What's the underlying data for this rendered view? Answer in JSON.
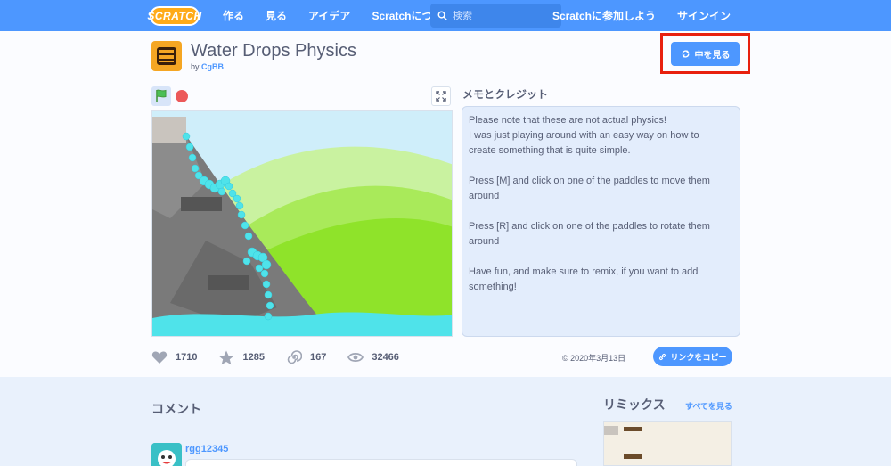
{
  "nav": {
    "logo": "SCRATCH",
    "links": [
      "作る",
      "見る",
      "アイデア",
      "Scratchについて"
    ],
    "search_placeholder": "検索",
    "join": "Scratchに参加しよう",
    "signin": "サインイン"
  },
  "project": {
    "title": "Water Drops Physics",
    "by_prefix": "by",
    "author": "CgBB",
    "see_inside": "中を見る"
  },
  "notes": {
    "title": "メモとクレジット",
    "lines": [
      "Please note that these are not actual physics!",
      "I was just playing around with an easy way on how to",
      "create something that is quite simple.",
      "",
      "Press [M] and click on one of the paddles to move them",
      "around",
      "",
      "Press [R] and click on one of the paddles to rotate them",
      "around",
      "",
      "Have fun, and make sure to remix, if you want to add",
      "something!"
    ]
  },
  "stats": {
    "loves": "1710",
    "favorites": "1285",
    "remixes": "167",
    "views": "32466"
  },
  "meta": {
    "date": "© 2020年3月13日",
    "copy_link": "リンクをコピー"
  },
  "comments": {
    "title": "コメント",
    "first_user": "rgg12345"
  },
  "remixes": {
    "title": "リミックス",
    "see_all": "すべてを見る"
  },
  "colors": {
    "nav_blue": "#4d97ff",
    "highlight_red": "#e8200e",
    "text": "#575e75",
    "notes_bg": "#e3edfc"
  }
}
